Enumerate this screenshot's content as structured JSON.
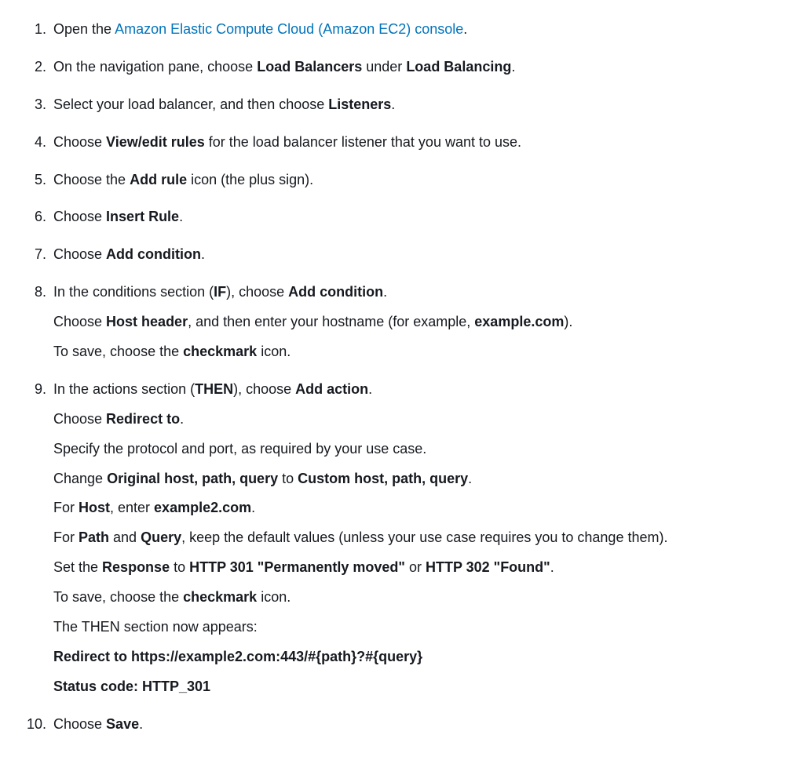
{
  "steps": [
    {
      "lines": [
        {
          "segments": [
            {
              "text": "Open the "
            },
            {
              "text": "Amazon Elastic Compute Cloud (Amazon EC2) console",
              "link": true
            },
            {
              "text": "."
            }
          ]
        }
      ]
    },
    {
      "lines": [
        {
          "segments": [
            {
              "text": "On the navigation pane, choose "
            },
            {
              "text": "Load Balancers",
              "bold": true
            },
            {
              "text": " under "
            },
            {
              "text": "Load Balancing",
              "bold": true
            },
            {
              "text": "."
            }
          ]
        }
      ]
    },
    {
      "lines": [
        {
          "segments": [
            {
              "text": "Select your load balancer, and then choose "
            },
            {
              "text": "Listeners",
              "bold": true
            },
            {
              "text": "."
            }
          ]
        }
      ]
    },
    {
      "lines": [
        {
          "segments": [
            {
              "text": "Choose "
            },
            {
              "text": "View/edit rules",
              "bold": true
            },
            {
              "text": " for the load balancer listener that you want to use."
            }
          ]
        }
      ]
    },
    {
      "lines": [
        {
          "segments": [
            {
              "text": "Choose the "
            },
            {
              "text": "Add rule",
              "bold": true
            },
            {
              "text": " icon (the plus sign)."
            }
          ]
        }
      ]
    },
    {
      "lines": [
        {
          "segments": [
            {
              "text": "Choose "
            },
            {
              "text": "Insert Rule",
              "bold": true
            },
            {
              "text": "."
            }
          ]
        }
      ]
    },
    {
      "lines": [
        {
          "segments": [
            {
              "text": "Choose "
            },
            {
              "text": "Add condition",
              "bold": true
            },
            {
              "text": "."
            }
          ]
        }
      ]
    },
    {
      "lines": [
        {
          "segments": [
            {
              "text": "In the conditions section ("
            },
            {
              "text": "IF",
              "bold": true
            },
            {
              "text": "), choose "
            },
            {
              "text": "Add condition",
              "bold": true
            },
            {
              "text": "."
            }
          ]
        },
        {
          "segments": [
            {
              "text": "Choose "
            },
            {
              "text": "Host header",
              "bold": true
            },
            {
              "text": ", and then enter your hostname (for example, "
            },
            {
              "text": "example.com",
              "bold": true
            },
            {
              "text": ")."
            }
          ]
        },
        {
          "segments": [
            {
              "text": "To save, choose the "
            },
            {
              "text": "checkmark",
              "bold": true
            },
            {
              "text": " icon."
            }
          ]
        }
      ]
    },
    {
      "lines": [
        {
          "segments": [
            {
              "text": "In the actions section ("
            },
            {
              "text": "THEN",
              "bold": true
            },
            {
              "text": "), choose "
            },
            {
              "text": "Add action",
              "bold": true
            },
            {
              "text": "."
            }
          ]
        },
        {
          "segments": [
            {
              "text": "Choose "
            },
            {
              "text": "Redirect to",
              "bold": true
            },
            {
              "text": "."
            }
          ]
        },
        {
          "segments": [
            {
              "text": "Specify the protocol and port, as required by your use case."
            }
          ]
        },
        {
          "segments": [
            {
              "text": "Change "
            },
            {
              "text": "Original host, path, query",
              "bold": true
            },
            {
              "text": " to "
            },
            {
              "text": "Custom host, path, query",
              "bold": true
            },
            {
              "text": "."
            }
          ]
        },
        {
          "segments": [
            {
              "text": "For "
            },
            {
              "text": "Host",
              "bold": true
            },
            {
              "text": ", enter "
            },
            {
              "text": "example2.com",
              "bold": true
            },
            {
              "text": "."
            }
          ]
        },
        {
          "segments": [
            {
              "text": "For "
            },
            {
              "text": "Path",
              "bold": true
            },
            {
              "text": " and "
            },
            {
              "text": "Query",
              "bold": true
            },
            {
              "text": ", keep the default values (unless your use case requires you to change them)."
            }
          ]
        },
        {
          "segments": [
            {
              "text": "Set the "
            },
            {
              "text": "Response",
              "bold": true
            },
            {
              "text": " to "
            },
            {
              "text": "HTTP 301 \"Permanently moved\"",
              "bold": true
            },
            {
              "text": " or "
            },
            {
              "text": "HTTP 302 \"Found\"",
              "bold": true
            },
            {
              "text": "."
            }
          ]
        },
        {
          "segments": [
            {
              "text": "To save, choose the "
            },
            {
              "text": "checkmark",
              "bold": true
            },
            {
              "text": " icon."
            }
          ]
        },
        {
          "segments": [
            {
              "text": "The THEN section now appears:"
            }
          ]
        },
        {
          "segments": [
            {
              "text": "Redirect to https://example2.com:443/#{path}?#{query}",
              "bold": true
            }
          ]
        },
        {
          "segments": [
            {
              "text": "Status code: HTTP_301",
              "bold": true
            }
          ]
        }
      ]
    },
    {
      "lines": [
        {
          "segments": [
            {
              "text": "Choose "
            },
            {
              "text": "Save",
              "bold": true
            },
            {
              "text": "."
            }
          ]
        }
      ]
    }
  ]
}
